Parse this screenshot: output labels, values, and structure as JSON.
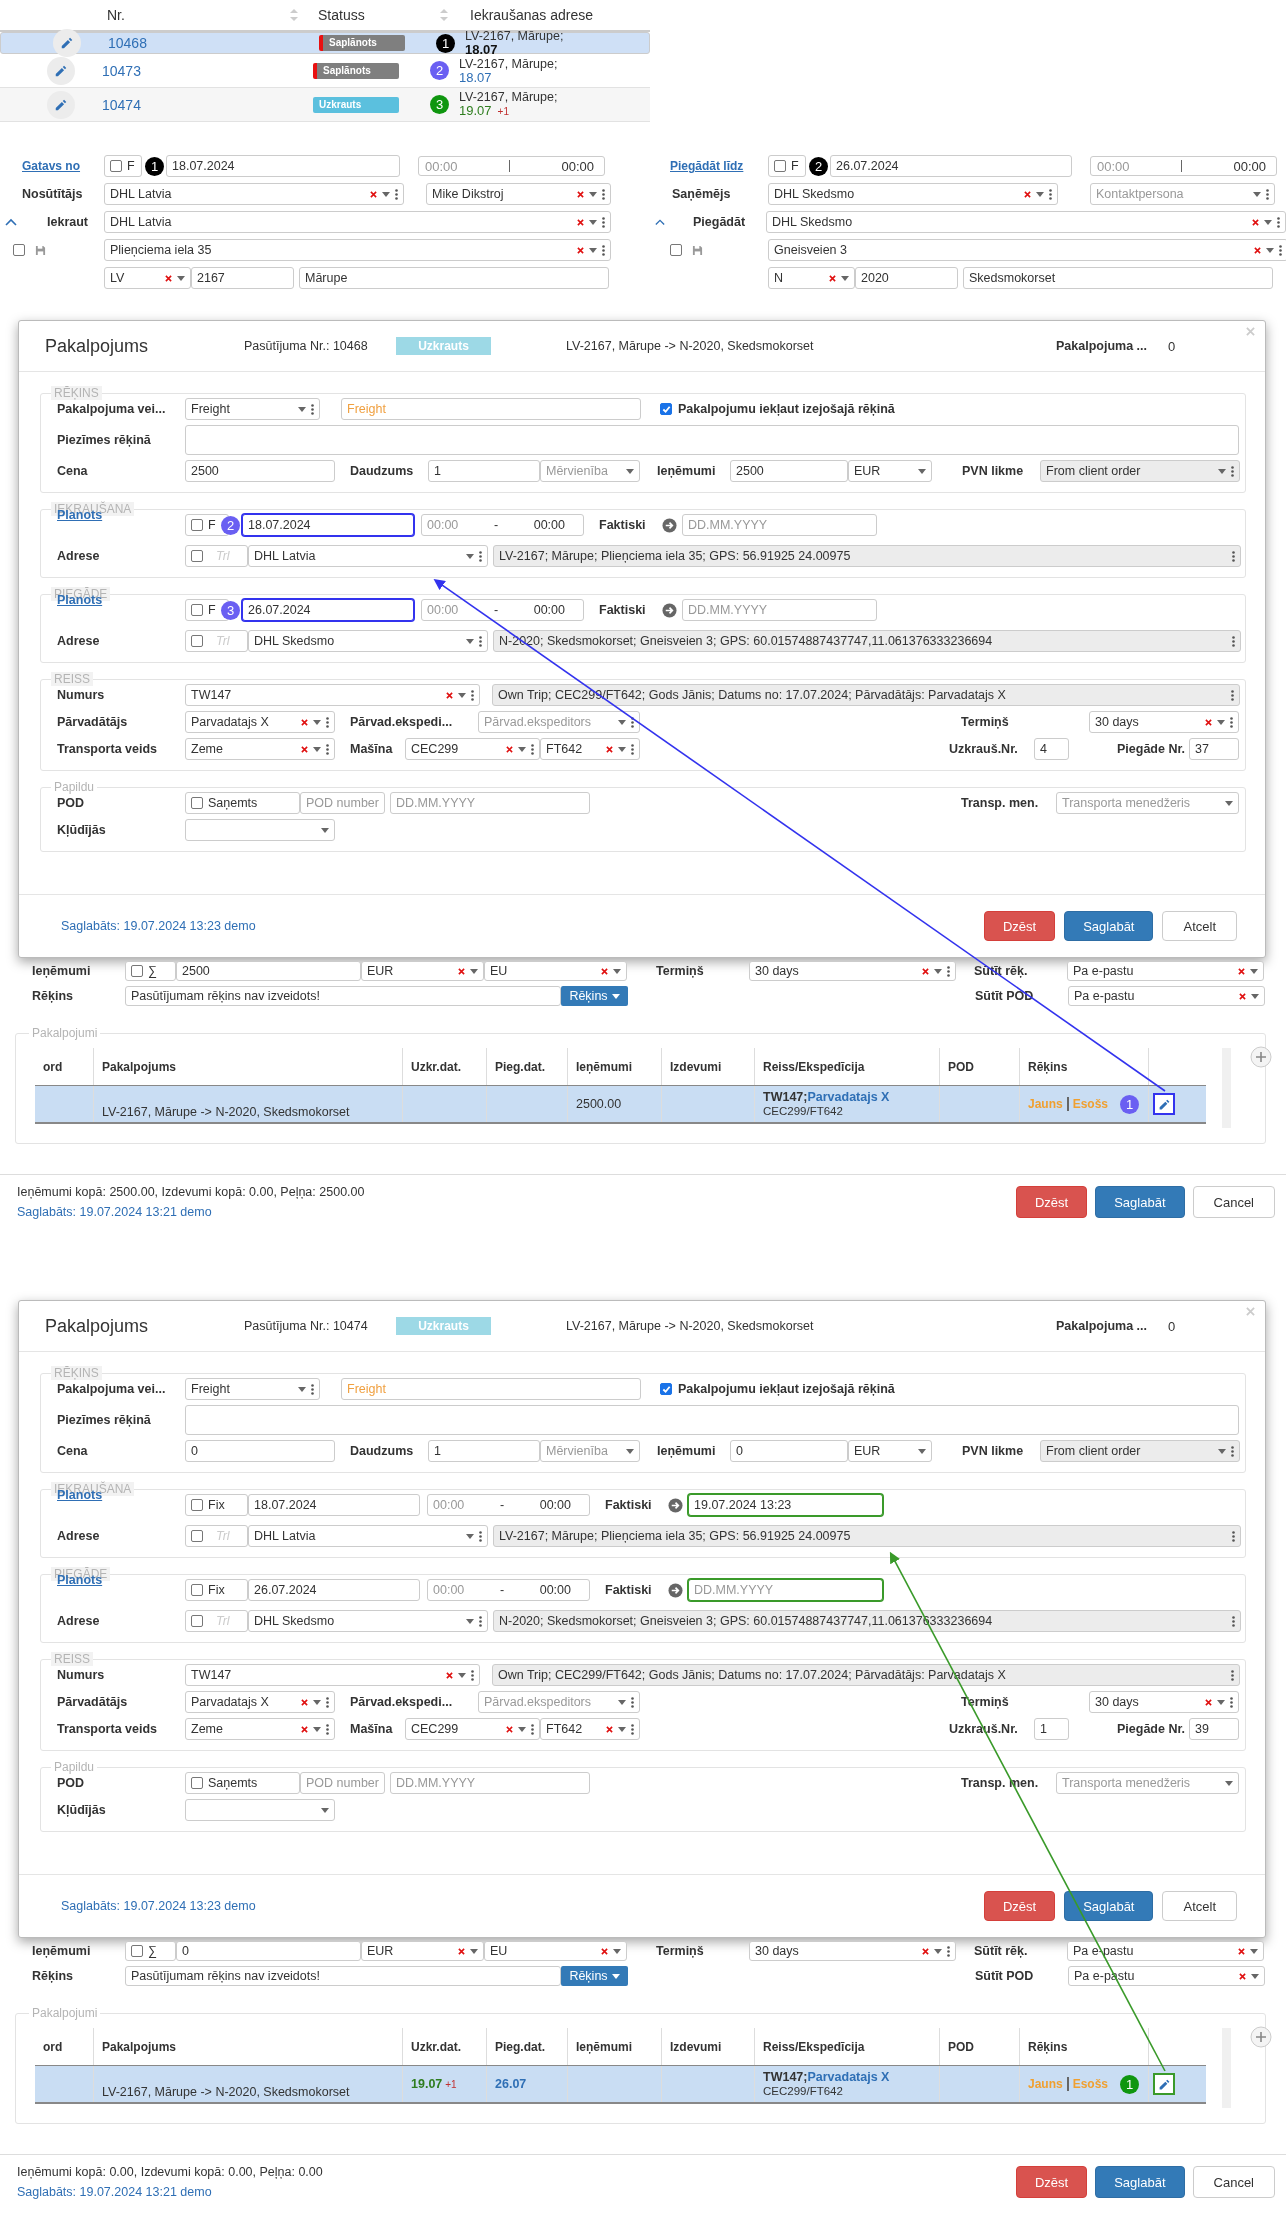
{
  "orders_table": {
    "columns": [
      "Nr.",
      "Statuss",
      "Iekraušanas adrese"
    ],
    "rows": [
      {
        "selected": true,
        "nr": "10468",
        "status": {
          "label": "Saplānots",
          "kind": "planned"
        },
        "marker": {
          "label": "1",
          "color": "#000000"
        },
        "address": "LV-2167, Mārupe;",
        "date": {
          "text": "18.07",
          "kind": "plain"
        }
      },
      {
        "selected": false,
        "nr": "10473",
        "status": {
          "label": "Saplānots",
          "kind": "planned"
        },
        "marker": {
          "label": "2",
          "color": "#6a5ff2"
        },
        "address": "LV-2167, Mārupe;",
        "date": {
          "text": "18.07",
          "kind": "planned"
        }
      },
      {
        "selected": false,
        "nr": "10474",
        "status": {
          "label": "Uzkrauts",
          "kind": "loaded"
        },
        "marker": {
          "label": "3",
          "color": "#0f960f"
        },
        "address": "LV-2167, Mārupe;",
        "date": {
          "text": "19.07",
          "kind": "actual"
        },
        "extra": "+1"
      }
    ]
  },
  "route": {
    "pickup": {
      "link": "Gatavs no",
      "fix_checked": false,
      "fix_label": "F",
      "marker": "1",
      "date": "18.07.2024",
      "time_from_placeholder": "00:00",
      "time_to": "00:00",
      "party_label": "Nosūtītājs",
      "party": "DHL Latvia",
      "contact": "Mike Dikstroj",
      "expanded": true,
      "place_label": "Iekraut",
      "place": "DHL Latvia",
      "save_checked": false,
      "street": "Plieņciema iela 35",
      "country": "LV",
      "zip": "2167",
      "city": "Mārupe"
    },
    "delivery": {
      "link": "Piegādāt līdz",
      "fix_checked": false,
      "fix_label": "F",
      "marker": "2",
      "date": "26.07.2024",
      "time_from_placeholder": "00:00",
      "time_to": "00:00",
      "party_label": "Saņēmējs",
      "party": "DHL Skedsmo",
      "contact_placeholder": "Kontaktpersona",
      "expanded": true,
      "place_label": "Piegādāt",
      "place": "DHL Skedsmo",
      "save_checked": false,
      "street": "Gneisveien 3",
      "country": "N",
      "zip": "2020",
      "city": "Skedsmokorset"
    }
  },
  "panels": [
    {
      "color": "#3333ee",
      "badge": {
        "color": "#6a5ff2"
      },
      "dialog": {
        "title": "Pakalpojums",
        "order_no": "Pasūtījuma Nr.: 10468",
        "status": "Uzkrauts",
        "route": "LV-2167, Mārupe -> N-2020, Skedsmokorset",
        "service_label": "Pakalpojuma ...",
        "service_value": "0",
        "invoice": {
          "legend": "RĒĶINS",
          "type_label": "Pakalpojuma vei...",
          "type": "Freight",
          "type_name": "Freight",
          "include_checked": true,
          "include_label": "Pakalpojumu iekļaut izejošajā rēķinā",
          "notes_label": "Piezīmes rēķinā",
          "price_label": "Cena",
          "price": "2500",
          "qty_label": "Daudzums",
          "qty": "1",
          "unit_placeholder": "Mērvienība",
          "revenue_label": "Ieņēmumi",
          "revenue": "2500",
          "currency": "EUR",
          "vat_label": "PVN likme",
          "vat": "From client order"
        },
        "stops": [
          {
            "legend": "IEKRAUŠANA",
            "link": "Planots",
            "fix_checked": false,
            "fix_label": "F",
            "marker": "2",
            "date": "18.07.2024",
            "date_highlighted": true,
            "time_from_placeholder": "00:00",
            "time_separator": "-",
            "time_to": "00:00",
            "actual_label": "Faktiski",
            "actual_placeholder": "DD.MM.YYYY",
            "actual_highlighted": false,
            "address_label": "Adrese",
            "trailer_checked": false,
            "trailer_placeholder": "Trl",
            "company": "DHL Latvia",
            "address": "LV-2167; Mārupe; Plieņciema iela 35; GPS: 56.91925 24.00975"
          },
          {
            "legend": "PIEGĀDE",
            "link": "Planots",
            "fix_checked": false,
            "fix_label": "F",
            "marker": "3",
            "date": "26.07.2024",
            "date_highlighted": true,
            "time_from_placeholder": "00:00",
            "time_separator": "-",
            "time_to": "00:00",
            "actual_label": "Faktiski",
            "actual_placeholder": "DD.MM.YYYY",
            "actual_highlighted": false,
            "address_label": "Adrese",
            "trailer_checked": false,
            "trailer_placeholder": "Trl",
            "company": "DHL Skedsmo",
            "address": "N-2020; Skedsmokorset; Gneisveien 3; GPS: 60.01574887437747,11.061376333236694"
          }
        ],
        "trip": {
          "legend": "REISS",
          "number_label": "Numurs",
          "number": "TW147",
          "info": "Own Trip; CEC299/FT642; Gods Jānis; Datums no: 17.07.2024; Pārvadātājs: Parvadatajs X",
          "carrier_label": "Pārvadātājs",
          "carrier": "Parvadatajs X",
          "forwarder_label": "Pārvad.ekspedi...",
          "forwarder_placeholder": "Pārvad.ekspeditors",
          "term_label": "Termiņš",
          "term": "30 days",
          "transport_label": "Transporta veids",
          "transport": "Zeme",
          "vehicle_label": "Mašīna",
          "truck": "CEC299",
          "trailer": "FT642",
          "loading_no_label": "Uzkrauš.Nr.",
          "loading_no": "4",
          "delivery_no_label": "Piegāde Nr.",
          "delivery_no": "37"
        },
        "extra": {
          "legend": "Papildu",
          "pod_label": "POD",
          "received_checked": false,
          "received_label": "Saņemts",
          "pod_number_placeholder": "POD number",
          "pod_date_placeholder": "DD.MM.YYYY",
          "manager_label": "Transp. men.",
          "manager_placeholder": "Transporta menedžeris",
          "errors_label": "Kļūdījās"
        },
        "footer": {
          "saved": "Saglabāts: 19.07.2024 13:23 demo",
          "delete": "Dzēst",
          "save": "Saglabāt",
          "cancel": "Atcelt"
        }
      },
      "page": {
        "revenue_label": "Ieņēmumi",
        "sum_checked": false,
        "sum_label": "∑",
        "revenue": "2500",
        "currency": "EUR",
        "vat": "EU",
        "term_label": "Termiņš",
        "term": "30 days",
        "send_invoice_label": "Sūtīt rēķ.",
        "send_invoice": "Pa e-pastu",
        "invoice_label": "Rēķins",
        "invoice_status": "Pasūtījumam rēķins nav izveidots!",
        "invoice_button": "Rēķins",
        "send_pod_label": "Sūtīt POD",
        "send_pod": "Pa e-pastu",
        "services": {
          "legend": "Pakalpojumi",
          "columns": [
            "ord",
            "Pakalpojums",
            "Uzkr.dat.",
            "Pieg.dat.",
            "Ieņēmumi",
            "Izdevumi",
            "Reiss/Ekspedīcija",
            "POD",
            "Rēķins"
          ],
          "rows": [
            {
              "selected": true,
              "service": "LV-2167, Mārupe -> N-2020, Skedsmokorset",
              "revenue": "2500.00",
              "trip": "TW147;",
              "carrier": "Parvadatajs X",
              "vehicles": "CEC299/FT642",
              "invoice_new": "Jauns",
              "invoice_existing": "Esošs",
              "marker": "1",
              "edit_highlighted": true
            }
          ]
        },
        "totals": "Ieņēmumi kopā: 2500.00, Izdevumi kopā: 0.00, Peļņa: 2500.00",
        "saved": "Saglabāts: 19.07.2024 13:21 demo",
        "delete": "Dzēst",
        "save": "Saglabāt",
        "cancel": "Cancel"
      }
    },
    {
      "color": "#3a9a2a",
      "badge": {
        "color": "#0f960f"
      },
      "dialog": {
        "title": "Pakalpojums",
        "order_no": "Pasūtījuma Nr.: 10474",
        "status": "Uzkrauts",
        "route": "LV-2167, Mārupe -> N-2020, Skedsmokorset",
        "service_label": "Pakalpojuma ...",
        "service_value": "0",
        "invoice": {
          "legend": "RĒĶINS",
          "type_label": "Pakalpojuma vei...",
          "type": "Freight",
          "type_name": "Freight",
          "include_checked": true,
          "include_label": "Pakalpojumu iekļaut izejošajā rēķinā",
          "notes_label": "Piezīmes rēķinā",
          "price_label": "Cena",
          "price": "0",
          "qty_label": "Daudzums",
          "qty": "1",
          "unit_placeholder": "Mērvienība",
          "revenue_label": "Ieņēmumi",
          "revenue": "0",
          "currency": "EUR",
          "vat_label": "PVN likme",
          "vat": "From client order"
        },
        "stops": [
          {
            "legend": "IEKRAUŠANA",
            "link": "Planots",
            "fix_checked": false,
            "fix_label": "Fix",
            "date": "18.07.2024",
            "date_highlighted": false,
            "time_from_placeholder": "00:00",
            "time_separator": "-",
            "time_to": "00:00",
            "actual_label": "Faktiski",
            "actual": "19.07.2024 13:23",
            "actual_highlighted": true,
            "address_label": "Adrese",
            "trailer_checked": false,
            "trailer_placeholder": "Trl",
            "company": "DHL Latvia",
            "address": "LV-2167; Mārupe; Plieņciema iela 35; GPS: 56.91925 24.00975"
          },
          {
            "legend": "PIEGĀDE",
            "link": "Planots",
            "fix_checked": false,
            "fix_label": "Fix",
            "date": "26.07.2024",
            "date_highlighted": false,
            "time_from_placeholder": "00:00",
            "time_separator": "-",
            "time_to": "00:00",
            "actual_label": "Faktiski",
            "actual_placeholder": "DD.MM.YYYY",
            "actual_highlighted": true,
            "address_label": "Adrese",
            "trailer_checked": false,
            "trailer_placeholder": "Trl",
            "company": "DHL Skedsmo",
            "address": "N-2020; Skedsmokorset; Gneisveien 3; GPS: 60.01574887437747,11.061376333236694"
          }
        ],
        "trip": {
          "legend": "REISS",
          "number_label": "Numurs",
          "number": "TW147",
          "info": "Own Trip; CEC299/FT642; Gods Jānis; Datums no: 17.07.2024; Pārvadātājs: Parvadatajs X",
          "carrier_label": "Pārvadātājs",
          "carrier": "Parvadatajs X",
          "forwarder_label": "Pārvad.ekspedi...",
          "forwarder_placeholder": "Pārvad.ekspeditors",
          "term_label": "Termiņš",
          "term": "30 days",
          "transport_label": "Transporta veids",
          "transport": "Zeme",
          "vehicle_label": "Mašīna",
          "truck": "CEC299",
          "trailer": "FT642",
          "loading_no_label": "Uzkrauš.Nr.",
          "loading_no": "1",
          "delivery_no_label": "Piegāde Nr.",
          "delivery_no": "39"
        },
        "extra": {
          "legend": "Papildu",
          "pod_label": "POD",
          "received_checked": false,
          "received_label": "Saņemts",
          "pod_number_placeholder": "POD number",
          "pod_date_placeholder": "DD.MM.YYYY",
          "manager_label": "Transp. men.",
          "manager_placeholder": "Transporta menedžeris",
          "errors_label": "Kļūdījās"
        },
        "footer": {
          "saved": "Saglabāts: 19.07.2024 13:23 demo",
          "delete": "Dzēst",
          "save": "Saglabāt",
          "cancel": "Atcelt"
        }
      },
      "page": {
        "revenue_label": "Ieņēmumi",
        "sum_checked": false,
        "sum_label": "∑",
        "revenue": "0",
        "currency": "EUR",
        "vat": "EU",
        "term_label": "Termiņš",
        "term": "30 days",
        "send_invoice_label": "Sūtīt rēķ.",
        "send_invoice": "Pa e-pastu",
        "invoice_label": "Rēķins",
        "invoice_status": "Pasūtījumam rēķins nav izveidots!",
        "invoice_button": "Rēķins",
        "send_pod_label": "Sūtīt POD",
        "send_pod": "Pa e-pastu",
        "services": {
          "legend": "Pakalpojumi",
          "columns": [
            "ord",
            "Pakalpojums",
            "Uzkr.dat.",
            "Pieg.dat.",
            "Ieņēmumi",
            "Izdevumi",
            "Reiss/Ekspedīcija",
            "POD",
            "Rēķins"
          ],
          "rows": [
            {
              "selected": true,
              "service": "LV-2167, Mārupe -> N-2020, Skedsmokorset",
              "loaded_date": "19.07",
              "loaded_extra": "+1",
              "delivered_date": "26.07",
              "trip": "TW147;",
              "carrier": "Parvadatajs X",
              "vehicles": "CEC299/FT642",
              "invoice_new": "Jauns",
              "invoice_existing": "Esošs",
              "marker": "1",
              "edit_highlighted": true
            }
          ]
        },
        "totals": "Ieņēmumi kopā: 0.00, Izdevumi kopā: 0.00, Peļņa: 0.00",
        "saved": "Saglabāts: 19.07.2024 13:21 demo",
        "delete": "Dzēst",
        "save": "Saglabāt",
        "cancel": "Cancel"
      }
    }
  ]
}
